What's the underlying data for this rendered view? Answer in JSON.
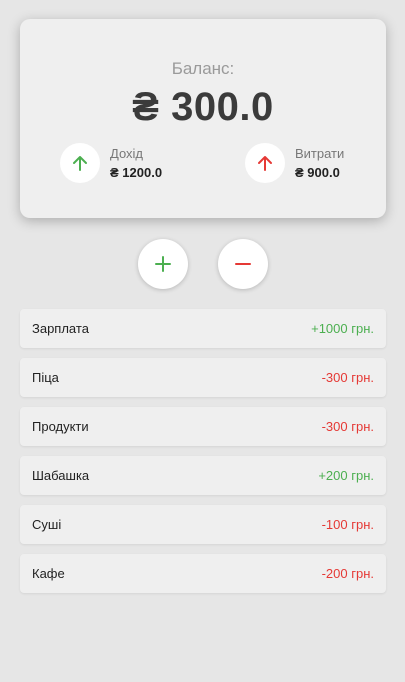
{
  "colors": {
    "income": "#4caf50",
    "expense": "#e53935",
    "background": "#e6e6e6",
    "card": "#efefef"
  },
  "balance": {
    "label": "Баланс:",
    "value": "₴ 300.0"
  },
  "income": {
    "icon": "arrow-up-icon",
    "label": "Дохід",
    "amount": "₴ 1200.0"
  },
  "expense": {
    "icon": "arrow-up-icon",
    "label": "Витрати",
    "amount": "₴ 900.0"
  },
  "actions": {
    "add_icon": "plus-icon",
    "remove_icon": "minus-icon"
  },
  "transactions": [
    {
      "name": "Зарплата",
      "amount": "+1000 грн.",
      "type": "income"
    },
    {
      "name": "Піца",
      "amount": "-300 грн.",
      "type": "expense"
    },
    {
      "name": "Продукти",
      "amount": "-300 грн.",
      "type": "expense"
    },
    {
      "name": "Шабашка",
      "amount": "+200 грн.",
      "type": "income"
    },
    {
      "name": "Суші",
      "amount": "-100 грн.",
      "type": "expense"
    },
    {
      "name": "Кафе",
      "amount": "-200 грн.",
      "type": "expense"
    }
  ]
}
